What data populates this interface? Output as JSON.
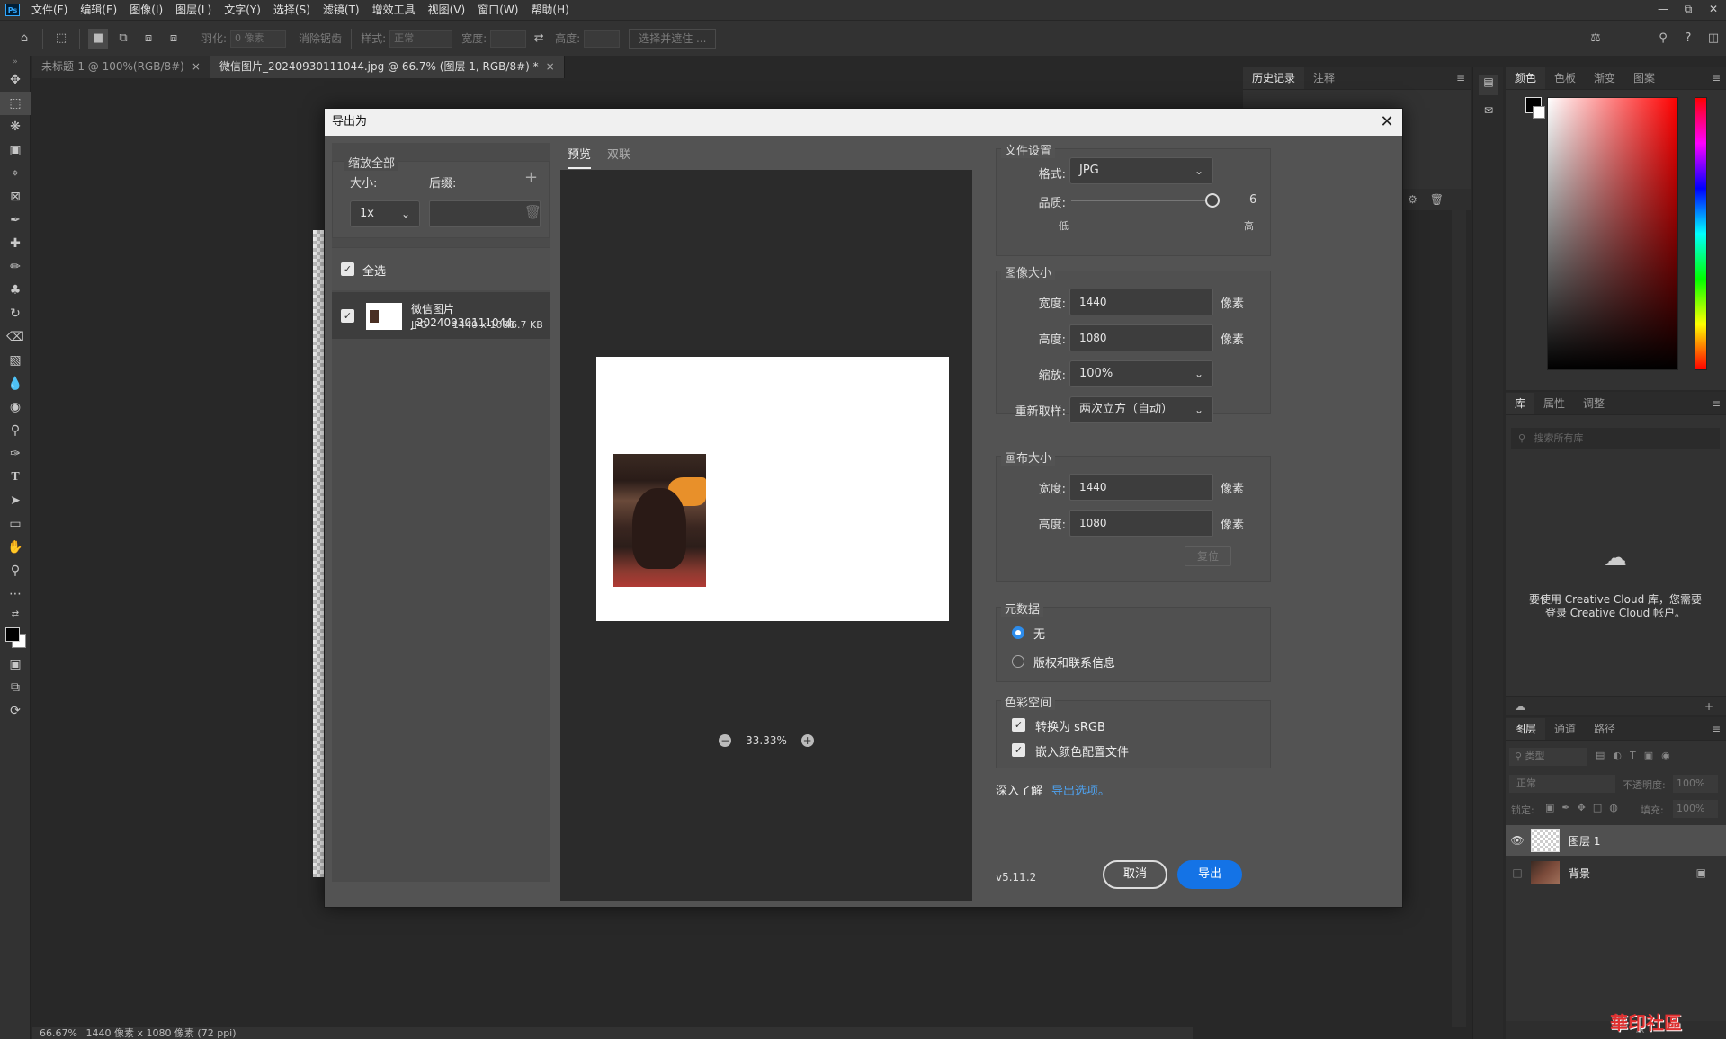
{
  "menubar": {
    "logo": "Ps",
    "items": [
      "文件(F)",
      "编辑(E)",
      "图像(I)",
      "图层(L)",
      "文字(Y)",
      "选择(S)",
      "滤镜(T)",
      "增效工具",
      "视图(V)",
      "窗口(W)",
      "帮助(H)"
    ]
  },
  "optionsbar": {
    "feather_label": "羽化:",
    "feather_value": "0 像素",
    "antialias_label": "消除锯齿",
    "style_label": "样式:",
    "style_value": "正常",
    "width_label": "宽度:",
    "height_label": "高度:",
    "select_subject": "选择并遮住 ..."
  },
  "doc_tabs": [
    {
      "label": "未标题-1 @ 100%(RGB/8#)"
    },
    {
      "label": "微信图片_20240930111044.jpg @ 66.7% (图层 1, RGB/8#) *"
    }
  ],
  "statusbar": {
    "zoom": "66.67%",
    "info": "1440 像素 x 1080 像素 (72 ppi)"
  },
  "history_panel": {
    "tabs": [
      "历史记录",
      "注释"
    ]
  },
  "color_panel": {
    "tabs": [
      "颜色",
      "色板",
      "渐变",
      "图案"
    ]
  },
  "library_panel": {
    "tabs": [
      "库",
      "属性",
      "调整"
    ],
    "search_placeholder": "搜索所有库",
    "message": "要使用 Creative Cloud 库，您需要登录 Creative Cloud 帐户。"
  },
  "layers_panel": {
    "tabs": [
      "图层",
      "通道",
      "路径"
    ],
    "filter_placeholder": "类型",
    "blend_mode": "正常",
    "opacity_label": "不透明度:",
    "opacity_value": "100%",
    "lock_label": "锁定:",
    "fill_label": "填充:",
    "fill_value": "100%",
    "layers": [
      {
        "name": "图层 1"
      },
      {
        "name": "背景"
      }
    ]
  },
  "export_dialog": {
    "title": "导出为",
    "scale_all": "缩放全部",
    "size_label": "大小:",
    "suffix_label": "后缀:",
    "size_value": "1x",
    "select_all": "全选",
    "asset": {
      "name": "微信图片_20240930111044",
      "format": "JPG",
      "dims": "1440 x 1080",
      "size": "46.7 KB"
    },
    "preview_tabs": [
      "预览",
      "双联"
    ],
    "zoom": "33.33%",
    "file_settings": "文件设置",
    "format_label": "格式:",
    "format_value": "JPG",
    "quality_label": "品质:",
    "quality_value": "6",
    "quality_fraction": 0.6,
    "quality_low": "低",
    "quality_high": "高",
    "image_size": "图像大小",
    "width_label": "宽度:",
    "height_label": "高度:",
    "image_width": "1440",
    "image_height": "1080",
    "unit": "像素",
    "scale_label": "缩放:",
    "scale_value": "100%",
    "resample_label": "重新取样:",
    "resample_value": "两次立方（自动）",
    "canvas_size": "画布大小",
    "canvas_width": "1440",
    "canvas_height": "1080",
    "reset": "复位",
    "metadata": "元数据",
    "meta_none": "无",
    "meta_copyright": "版权和联系信息",
    "color_space": "色彩空间",
    "convert_srgb": "转换为 sRGB",
    "embed_profile": "嵌入颜色配置文件",
    "learn_more": "深入了解",
    "export_options_link": "导出选项。",
    "version": "v5.11.2",
    "cancel": "取消",
    "export": "导出"
  },
  "watermark": "華印社區"
}
